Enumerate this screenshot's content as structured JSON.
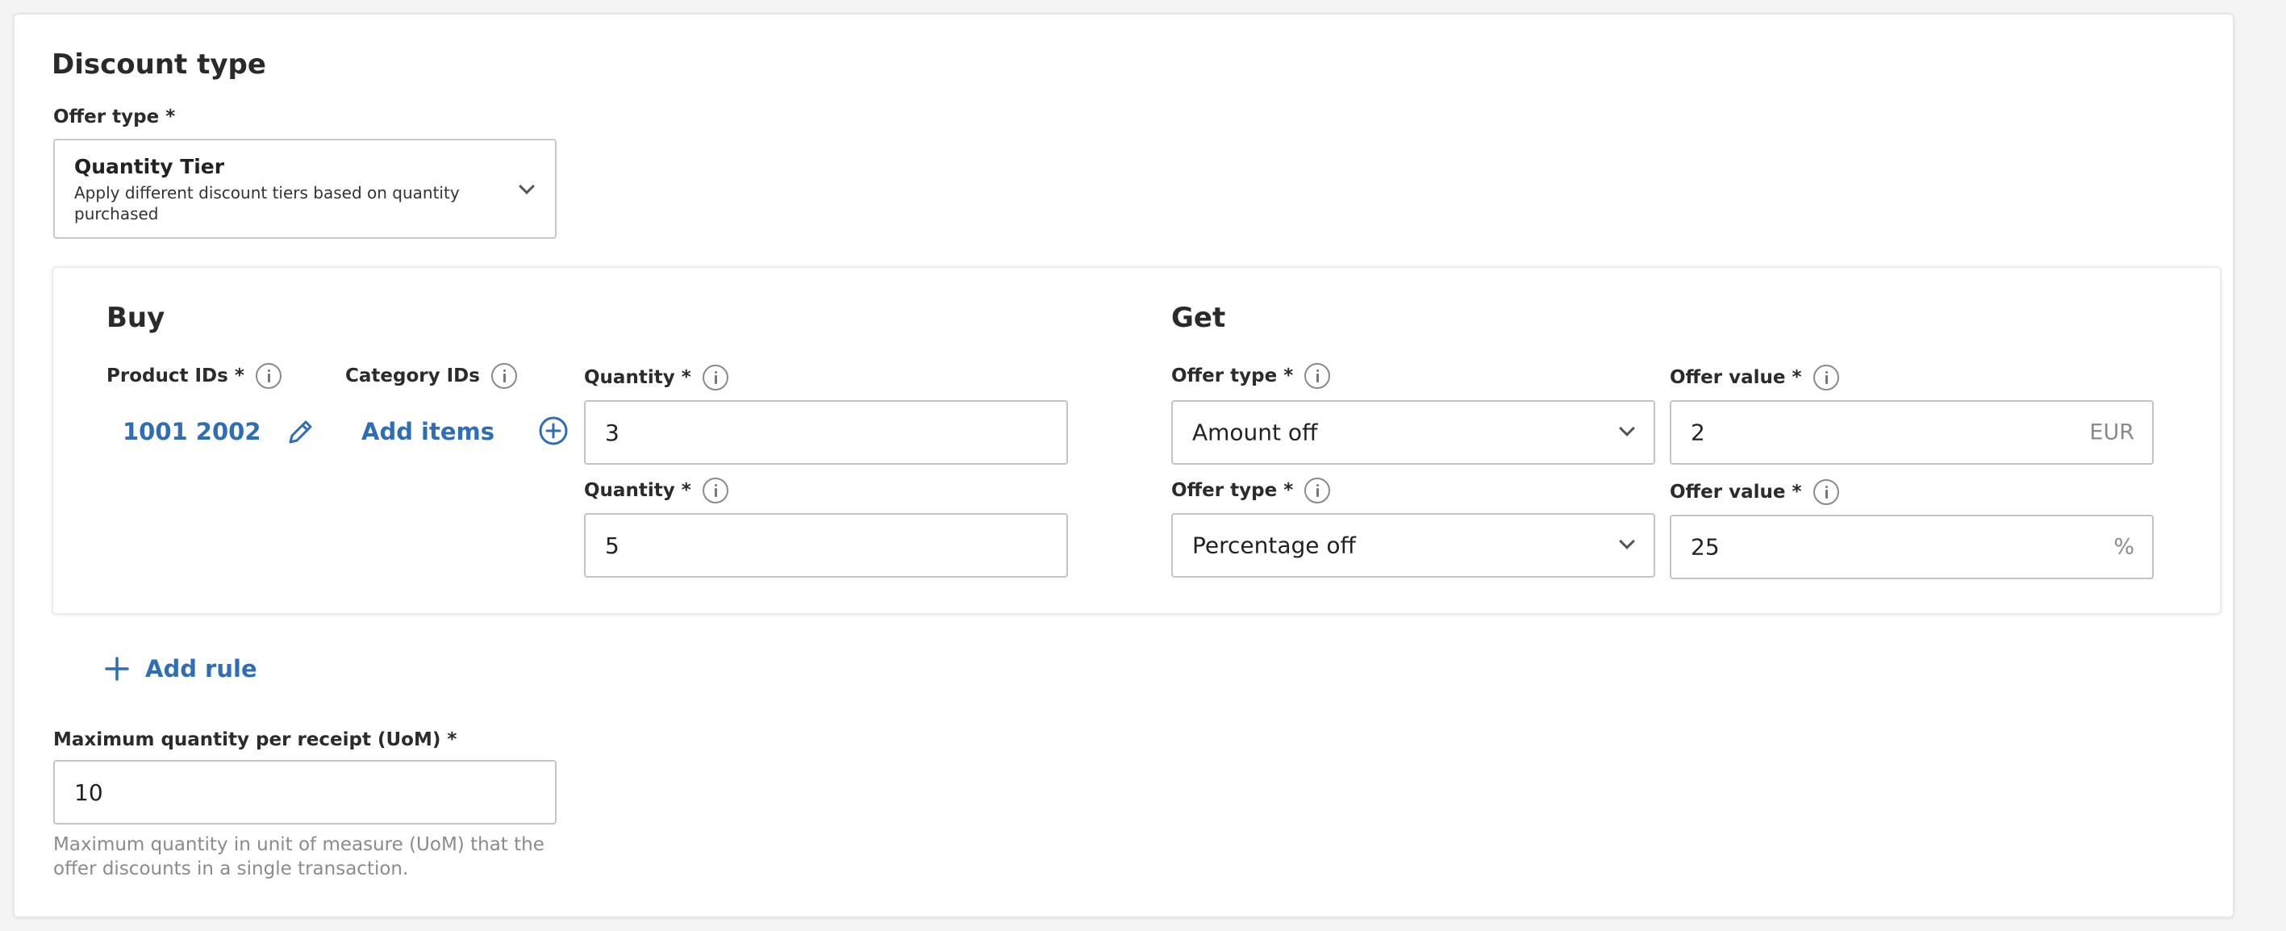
{
  "section_title": "Discount type",
  "offer_type_select": {
    "label": "Offer type *",
    "title": "Quantity Tier",
    "description": "Apply different discount tiers based on quantity purchased"
  },
  "buy": {
    "title": "Buy",
    "product_ids_label": "Product IDs *",
    "product_ids_value": "1001 2002",
    "category_ids_label": "Category IDs",
    "add_items_label": "Add items",
    "tiers": [
      {
        "quantity_label": "Quantity *",
        "quantity_value": "3"
      },
      {
        "quantity_label": "Quantity *",
        "quantity_value": "5"
      }
    ]
  },
  "get": {
    "title": "Get",
    "tiers": [
      {
        "offer_type_label": "Offer type *",
        "offer_type_value": "Amount off",
        "offer_value_label": "Offer value *",
        "offer_value": "2",
        "unit": "EUR"
      },
      {
        "offer_type_label": "Offer type *",
        "offer_type_value": "Percentage off",
        "offer_value_label": "Offer value *",
        "offer_value": "25",
        "unit": "%"
      }
    ]
  },
  "add_rule_label": "Add rule",
  "max_quantity": {
    "label": "Maximum quantity per receipt (UoM) *",
    "value": "10",
    "helper": "Maximum quantity in unit of measure (UoM) that the offer discounts in a single transaction."
  },
  "colors": {
    "link": "#2f6db4",
    "border": "#c4c4c8",
    "text": "#222222",
    "muted": "#8b8b8f"
  }
}
